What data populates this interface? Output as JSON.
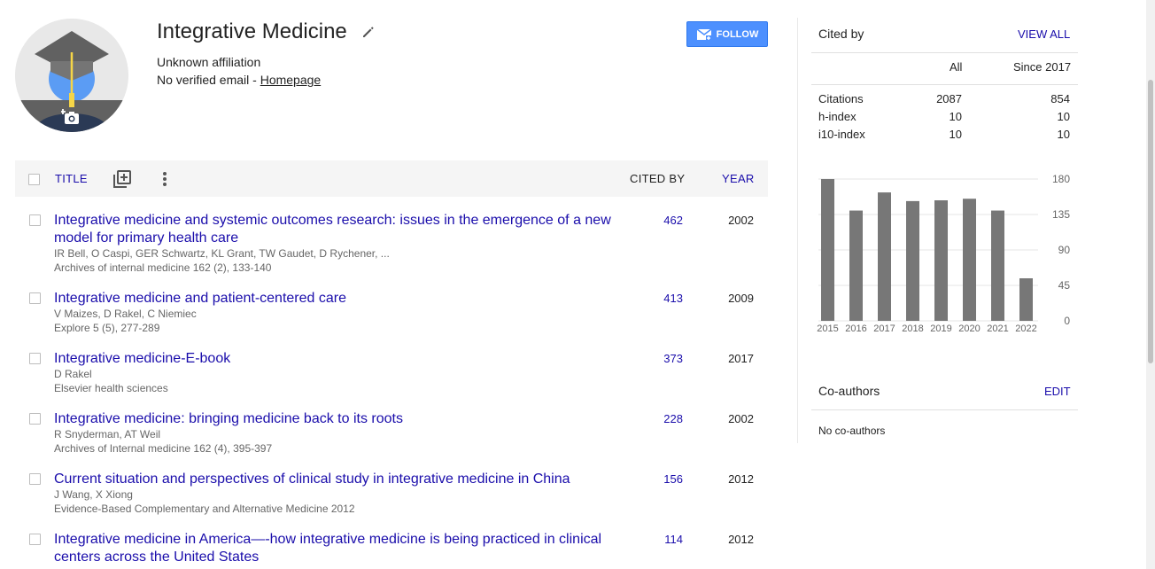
{
  "profile": {
    "name": "Integrative Medicine",
    "affiliation": "Unknown affiliation",
    "email_text": "No verified email - ",
    "homepage_label": "Homepage",
    "follow_label": "FOLLOW"
  },
  "table": {
    "header": {
      "title_label": "TITLE",
      "cited_by_label": "CITED BY",
      "year_label": "YEAR"
    },
    "rows": [
      {
        "title": "Integrative medicine and systemic outcomes research: issues in the emergence of a new model for primary health care",
        "authors": "IR Bell, O Caspi, GER Schwartz, KL Grant, TW Gaudet, D Rychener, ...",
        "venue": "Archives of internal medicine 162 (2), 133-140",
        "cited_by": "462",
        "year": "2002"
      },
      {
        "title": "Integrative medicine and patient-centered care",
        "authors": "V Maizes, D Rakel, C Niemiec",
        "venue": "Explore 5 (5), 277-289",
        "cited_by": "413",
        "year": "2009"
      },
      {
        "title": "Integrative medicine-E-book",
        "authors": "D Rakel",
        "venue": "Elsevier health sciences",
        "cited_by": "373",
        "year": "2017"
      },
      {
        "title": "Integrative medicine: bringing medicine back to its roots",
        "authors": "R Snyderman, AT Weil",
        "venue": "Archives of Internal medicine 162 (4), 395-397",
        "cited_by": "228",
        "year": "2002"
      },
      {
        "title": "Current situation and perspectives of clinical study in integrative medicine in China",
        "authors": "J Wang, X Xiong",
        "venue": "Evidence-Based Complementary and Alternative Medicine 2012",
        "cited_by": "156",
        "year": "2012"
      },
      {
        "title": "Integrative medicine in America—-how integrative medicine is being practiced in clinical centers across the United States",
        "authors": "",
        "venue": "",
        "cited_by": "114",
        "year": "2012"
      }
    ]
  },
  "cited_by": {
    "title": "Cited by",
    "view_all_label": "VIEW ALL",
    "columns": {
      "all": "All",
      "since": "Since 2017"
    },
    "metrics": [
      {
        "label": "Citations",
        "all": "2087",
        "since": "854"
      },
      {
        "label": "h-index",
        "all": "10",
        "since": "10"
      },
      {
        "label": "i10-index",
        "all": "10",
        "since": "10"
      }
    ]
  },
  "chart_data": {
    "type": "bar",
    "categories": [
      "2015",
      "2016",
      "2017",
      "2018",
      "2019",
      "2020",
      "2021",
      "2022"
    ],
    "values": [
      180,
      140,
      163,
      152,
      153,
      155,
      140,
      54
    ],
    "yticks": [
      180,
      135,
      90,
      45,
      0
    ],
    "ylim": [
      0,
      180
    ],
    "bar_color": "#777777",
    "grid": true
  },
  "coauthors": {
    "title": "Co-authors",
    "edit_label": "EDIT",
    "empty_text": "No co-authors"
  },
  "colors": {
    "link": "#1a0dab",
    "follow_button": "#4d90fe"
  }
}
